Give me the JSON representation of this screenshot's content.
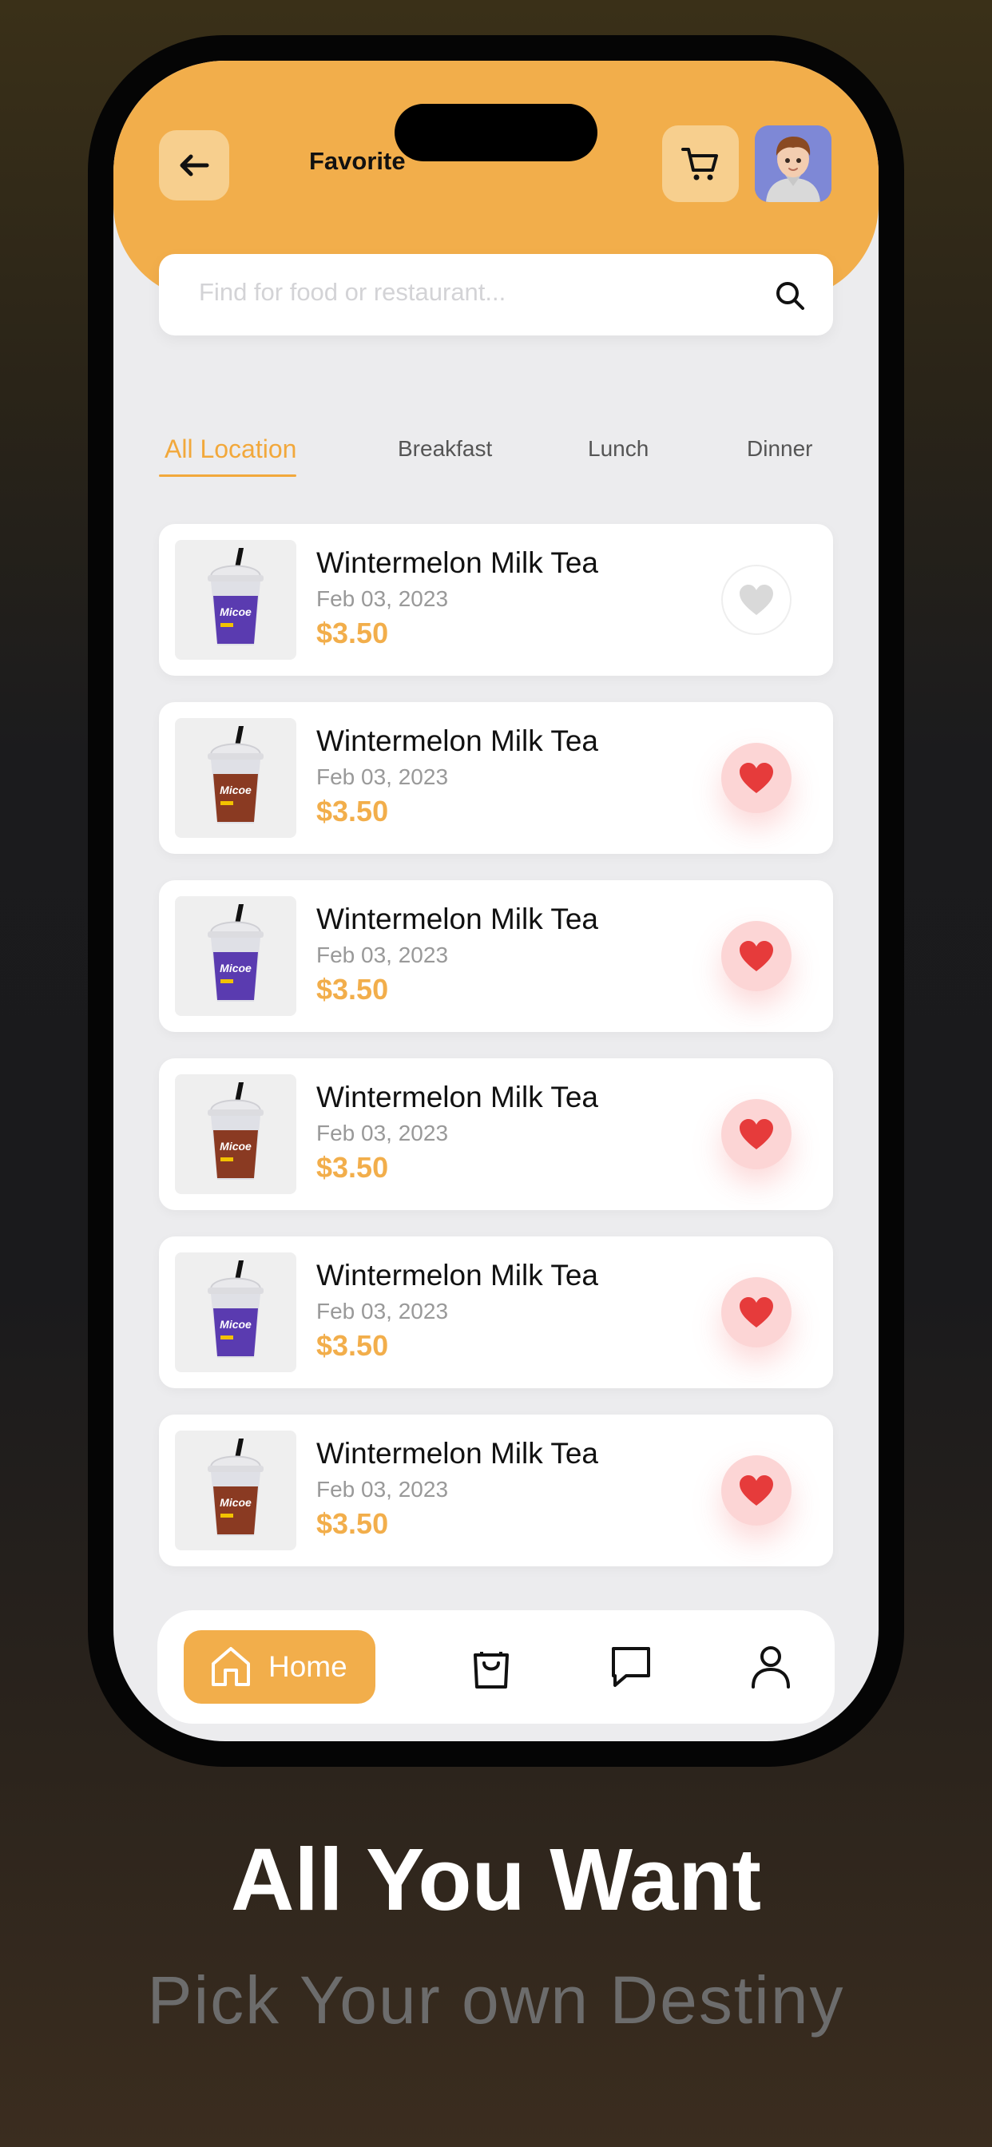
{
  "header": {
    "title": "Favorite",
    "back_icon": "arrow-left-icon",
    "cart_icon": "cart-icon",
    "accent_color": "#f2ae4b"
  },
  "search": {
    "placeholder": "Find for food or restaurant...",
    "value": "",
    "icon": "search-icon"
  },
  "tabs": [
    {
      "label": "All Location",
      "active": true
    },
    {
      "label": "Breakfast",
      "active": false
    },
    {
      "label": "Lunch",
      "active": false
    },
    {
      "label": "Dinner",
      "active": false
    }
  ],
  "items": [
    {
      "name": "Wintermelon Milk Tea",
      "date": "Feb 03, 2023",
      "price": "$3.50",
      "favorite": false,
      "drink_color": "#5a3bb0"
    },
    {
      "name": "Wintermelon Milk Tea",
      "date": "Feb 03, 2023",
      "price": "$3.50",
      "favorite": true,
      "drink_color": "#8a3a22"
    },
    {
      "name": "Wintermelon Milk Tea",
      "date": "Feb 03, 2023",
      "price": "$3.50",
      "favorite": true,
      "drink_color": "#5a3bb0"
    },
    {
      "name": "Wintermelon Milk Tea",
      "date": "Feb 03, 2023",
      "price": "$3.50",
      "favorite": true,
      "drink_color": "#8a3a22"
    },
    {
      "name": "Wintermelon Milk Tea",
      "date": "Feb 03, 2023",
      "price": "$3.50",
      "favorite": true,
      "drink_color": "#5a3bb0"
    },
    {
      "name": "Wintermelon Milk Tea",
      "date": "Feb 03, 2023",
      "price": "$3.50",
      "favorite": true,
      "drink_color": "#8a3a22"
    }
  ],
  "nav": {
    "home_label": "Home",
    "icons": [
      "home-icon",
      "shopping-bag-icon",
      "chat-icon",
      "user-icon"
    ]
  },
  "promo": {
    "headline": "All You Want",
    "subline": "Pick Your own Destiny"
  }
}
